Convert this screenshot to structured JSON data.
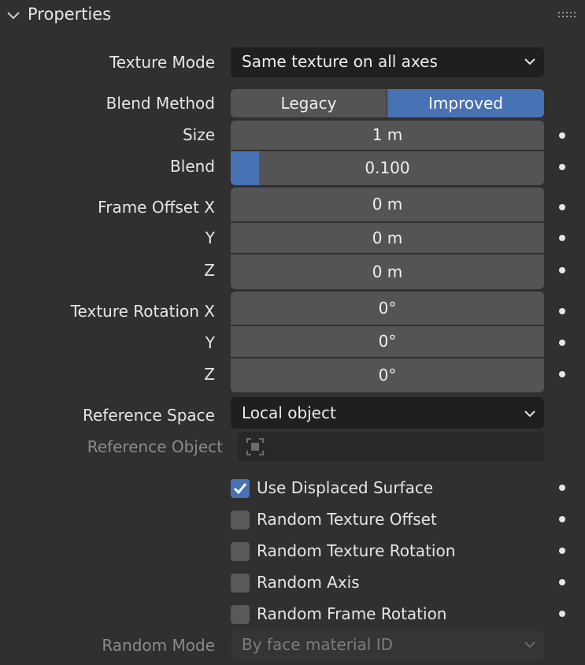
{
  "panel": {
    "title": "Properties",
    "collapse_icon": "chevron-down-icon",
    "grip_icon": "grip-dots-icon"
  },
  "texture_mode": {
    "label": "Texture Mode",
    "value": "Same texture on all axes"
  },
  "blend_method": {
    "label": "Blend Method",
    "options": [
      "Legacy",
      "Improved"
    ],
    "selected": "Improved"
  },
  "size": {
    "label": "Size",
    "value": "1 m"
  },
  "blend": {
    "label": "Blend",
    "value": "0.100",
    "fill_fraction": 0.1
  },
  "frame_offset": {
    "label_x": "Frame Offset X",
    "label_y": "Y",
    "label_z": "Z",
    "x": "0 m",
    "y": "0 m",
    "z": "0 m"
  },
  "texture_rotation": {
    "label_x": "Texture Rotation X",
    "label_y": "Y",
    "label_z": "Z",
    "x": "0°",
    "y": "0°",
    "z": "0°"
  },
  "reference_space": {
    "label": "Reference Space",
    "value": "Local object"
  },
  "reference_object": {
    "label": "Reference Object",
    "value": ""
  },
  "checkboxes": [
    {
      "label": "Use Displaced Surface",
      "checked": true
    },
    {
      "label": "Random Texture Offset",
      "checked": false
    },
    {
      "label": "Random Texture Rotation",
      "checked": false
    },
    {
      "label": "Random Axis",
      "checked": false
    },
    {
      "label": "Random Frame Rotation",
      "checked": false
    }
  ],
  "random_mode": {
    "label": "Random Mode",
    "value": "By face material ID"
  },
  "colors": {
    "accent": "#4772b3",
    "background": "#303030",
    "field": "#545454",
    "dropdown": "#1f1f1f"
  }
}
